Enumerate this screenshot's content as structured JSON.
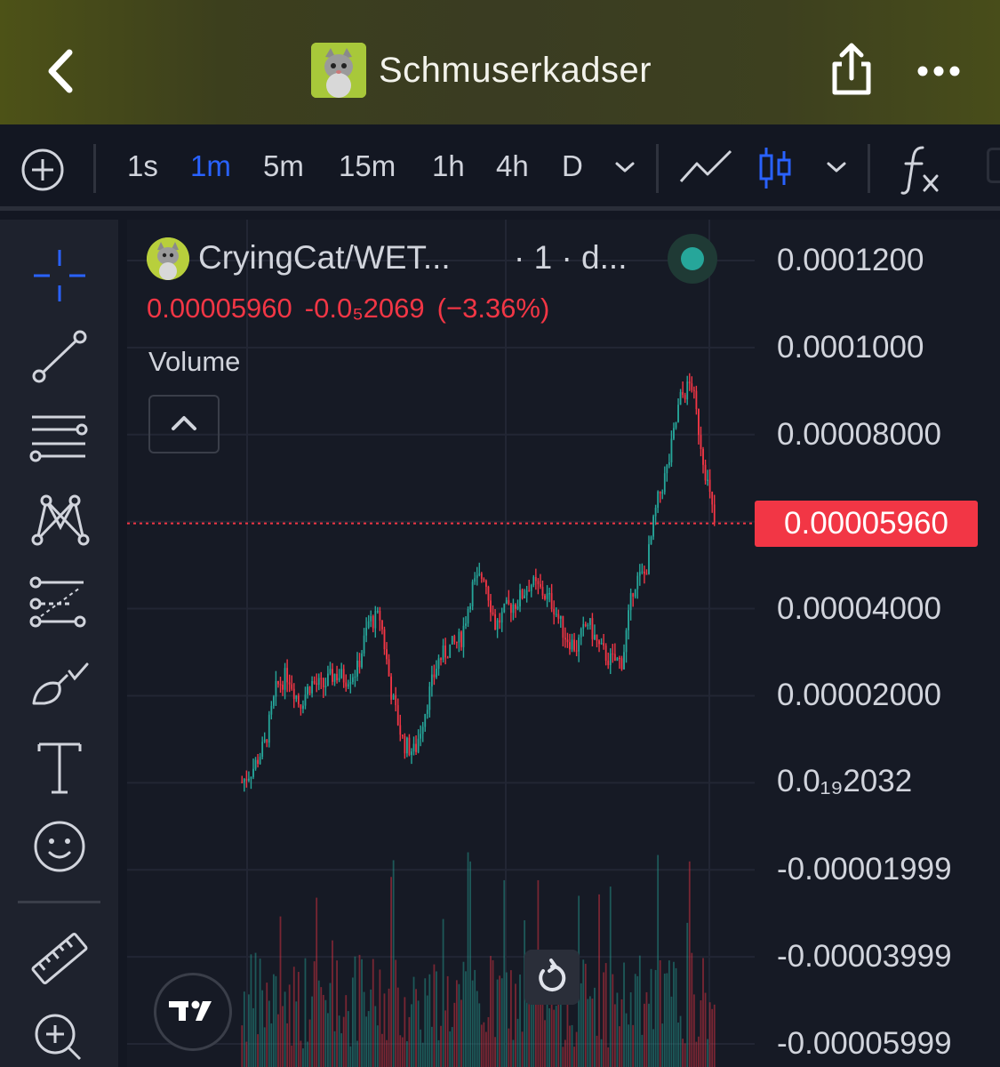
{
  "header": {
    "title": "Schmuserkadser",
    "bg_color": "#3d401f"
  },
  "toolbar": {
    "intervals": [
      "1s",
      "1m",
      "5m",
      "15m",
      "1h",
      "4h",
      "D"
    ],
    "active_interval": "1m",
    "accent": "#2962ff",
    "icons": [
      "add-circle-icon",
      "chevron-down-icon",
      "line-chart-icon",
      "candlestick-icon",
      "chevron-down-icon",
      "indicators-fx-icon"
    ]
  },
  "drawing_tools": [
    "crosshair-icon",
    "trend-line-icon",
    "horizontal-lines-icon",
    "pattern-icon",
    "fib-retracement-icon",
    "brush-icon",
    "text-icon",
    "emoji-icon",
    "ruler-icon",
    "zoom-in-icon"
  ],
  "legend": {
    "symbol": "CryingCat/WET...",
    "interval": "· 1 · d...",
    "price": "0.00005960",
    "change": "-0.0₅2069",
    "change_pct": "(−3.36%)",
    "volume_label": "Volume",
    "status": "online",
    "down_color": "#f23645",
    "up_color": "#26a69a"
  },
  "price_axis": {
    "labels": [
      "0.0001200",
      "0.0001000",
      "0.00008000",
      "0.00005960",
      "0.00004000",
      "0.00002000",
      "0.0₁₉2032",
      "-0.00001999",
      "-0.00003999",
      "-0.00005999"
    ],
    "current_price": "0.00005960"
  },
  "chart_data": {
    "type": "candlestick",
    "interval": "1m",
    "ylim": [
      -6e-05,
      0.00012
    ],
    "last_price": 5.96e-05,
    "close_path": [
      2e-07,
      3.5e-06,
      9e-06,
      2.2e-05,
      2.5e-05,
      1.8e-05,
      2.3e-05,
      2.2e-05,
      2.5e-05,
      2.4e-05,
      2.6e-05,
      3.7e-05,
      3.8e-05,
      2e-05,
      9e-06,
      7e-06,
      1.8e-05,
      2.8e-05,
      3.1e-05,
      3.3e-05,
      4.5e-05,
      4.8e-05,
      3.6e-05,
      4e-05,
      4.2e-05,
      4.6e-05,
      4.4e-05,
      4.1e-05,
      3.4e-05,
      3.1e-05,
      3.7e-05,
      3.1e-05,
      2.8e-05,
      2.8e-05,
      4.6e-05,
      4.8e-05,
      6.4e-05,
      7.3e-05,
      8.8e-05,
      9.2e-05,
      7.5e-05,
      5.96e-05
    ]
  }
}
